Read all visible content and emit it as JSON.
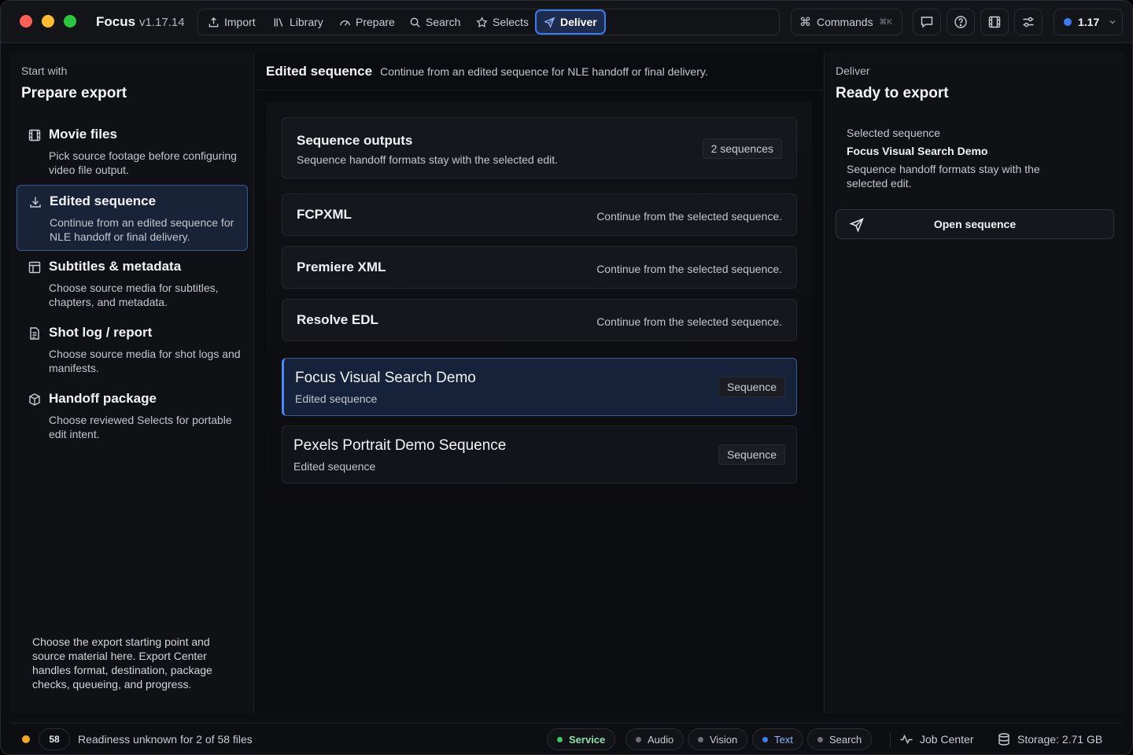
{
  "app": {
    "name": "Focus",
    "version": "v1.17.14"
  },
  "nav": {
    "items": [
      {
        "label": "Import"
      },
      {
        "label": "Library"
      },
      {
        "label": "Prepare"
      },
      {
        "label": "Search"
      },
      {
        "label": "Selects"
      },
      {
        "label": "Deliver"
      }
    ],
    "active": "Deliver"
  },
  "commands": {
    "label": "Commands",
    "shortcut": "⌘K"
  },
  "toolbar_icons": [
    "chat-icon",
    "help-icon",
    "film-icon",
    "settings-sliders-icon"
  ],
  "version_pill": {
    "label": "1.17",
    "dot_color": "#3d7bf2"
  },
  "left": {
    "eyebrow": "Start with",
    "title": "Prepare export",
    "options": [
      {
        "title": "Movie files",
        "desc": "Pick source footage before configuring video file output.",
        "icon": "film-icon"
      },
      {
        "title": "Edited sequence",
        "desc": "Continue from an edited sequence for NLE handoff or final delivery.",
        "icon": "download-icon",
        "active": true
      },
      {
        "title": "Subtitles & metadata",
        "desc": "Choose source media for subtitles, chapters, and metadata.",
        "icon": "table-icon"
      },
      {
        "title": "Shot log / report",
        "desc": "Choose source media for shot logs and manifests.",
        "icon": "document-icon"
      },
      {
        "title": "Handoff package",
        "desc": "Choose reviewed Selects for portable edit intent.",
        "icon": "package-icon"
      }
    ],
    "footer": "Choose the export starting point and source material here. Export Center handles format, destination, package checks, queueing, and progress."
  },
  "center": {
    "heading": "Edited sequence",
    "subheading": "Continue from an edited sequence for NLE handoff or final delivery.",
    "outputs_card": {
      "title": "Sequence outputs",
      "desc": "Sequence handoff formats stay with the selected edit.",
      "badge": "2 sequences"
    },
    "formats": [
      {
        "name": "FCPXML",
        "desc": "Continue from the selected sequence."
      },
      {
        "name": "Premiere XML",
        "desc": "Continue from the selected sequence."
      },
      {
        "name": "Resolve EDL",
        "desc": "Continue from the selected sequence."
      }
    ],
    "sequences": [
      {
        "name": "Focus Visual Search Demo",
        "sub": "Edited sequence",
        "badge": "Sequence",
        "active": true
      },
      {
        "name": "Pexels Portrait Demo Sequence",
        "sub": "Edited sequence",
        "badge": "Sequence"
      }
    ]
  },
  "right": {
    "eyebrow": "Deliver",
    "title": "Ready to export",
    "selected_label": "Selected sequence",
    "selected_name": "Focus Visual Search Demo",
    "selected_desc": "Sequence handoff formats stay with the selected edit.",
    "button": "Open sequence"
  },
  "status": {
    "indicator_color": "#f5a623",
    "count": "58",
    "message": "Readiness unknown for 2 of 58 files",
    "services": [
      {
        "label": "Service",
        "color": "#3fc76a",
        "text_color": "#8fe0a8"
      },
      {
        "label": "Audio",
        "color": "#6b6f78",
        "text_color": "#c9ccd4"
      },
      {
        "label": "Vision",
        "color": "#6b6f78",
        "text_color": "#c9ccd4"
      },
      {
        "label": "Text",
        "color": "#3d7bf2",
        "text_color": "#8fb3ff"
      },
      {
        "label": "Search",
        "color": "#6b6f78",
        "text_color": "#c9ccd4"
      }
    ],
    "job_center": "Job Center",
    "storage": "Storage: 2.71 GB"
  }
}
